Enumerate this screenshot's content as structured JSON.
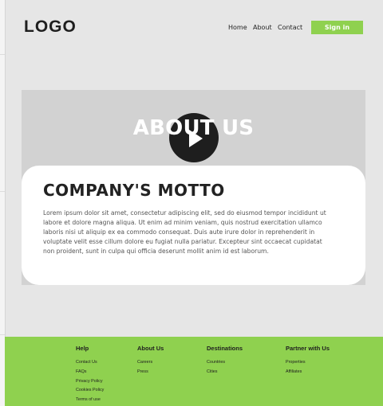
{
  "header": {
    "logo": "LOGO",
    "nav": [
      "Home",
      "About",
      "Contact"
    ],
    "signin_label": "Sign in"
  },
  "hero": {
    "title": "ABOUT US",
    "motto_title": "COMPANY'S MOTTO",
    "motto_text": "Lorem ipsum dolor sit amet, consectetur adipiscing elit, sed do eiusmod tempor incididunt ut labore et dolore magna aliqua. Ut enim ad minim veniam, quis nostrud exercitation ullamco laboris nisi ut aliquip ex ea commodo consequat. Duis aute irure dolor in reprehenderit in voluptate velit esse cillum dolore eu fugiat nulla pariatur. Excepteur sint occaecat cupidatat non proident, sunt in culpa qui officia deserunt mollit anim id est laborum."
  },
  "footer": {
    "columns": [
      {
        "title": "Help",
        "links": [
          "Contact Us",
          "FAQs",
          "Privacy Policy",
          "Cookies Policy",
          "Terms of use"
        ]
      },
      {
        "title": "About Us",
        "links": [
          "Careers",
          "Press"
        ]
      },
      {
        "title": "Destinations",
        "links": [
          "Countries",
          "Cities"
        ]
      },
      {
        "title": "Partner with Us",
        "links": [
          "Properties",
          "Affiliates"
        ]
      }
    ]
  },
  "colors": {
    "accent": "#8fd14f",
    "background": "#e6e6e6",
    "hero": "#d2d2d2",
    "dark": "#1e1e1e"
  },
  "icons": {
    "hero_play": "play-icon"
  }
}
